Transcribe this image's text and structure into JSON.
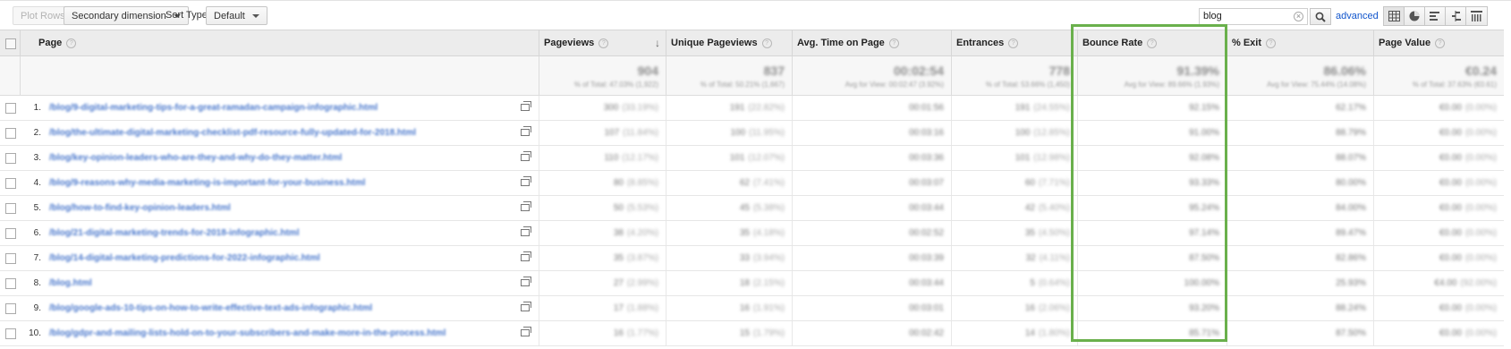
{
  "toolbar": {
    "plot_rows": "Plot Rows",
    "secondary_dimension": "Secondary dimension",
    "sort_type_label": "Sort Type:",
    "sort_type_value": "Default",
    "search_value": "blog",
    "advanced": "advanced"
  },
  "columns": {
    "page": "Page",
    "pageviews": "Pageviews",
    "unique_pageviews": "Unique Pageviews",
    "avg_time": "Avg. Time on Page",
    "entrances": "Entrances",
    "bounce_rate": "Bounce Rate",
    "exit": "% Exit",
    "page_value": "Page Value"
  },
  "totals": {
    "pageviews": "904",
    "unique_pageviews": "837",
    "avg_time": "00:02:54",
    "entrances": "778",
    "bounce_rate": "91.39%",
    "exit": "86.06%",
    "page_value": "€0.24"
  },
  "rows": [
    {
      "num": "1.",
      "page": "/blog/9-digital-marketing-tips-for-a-great-ramadan-campaign-infographic.html",
      "pv": "300",
      "pvp": "(33.19%)",
      "upv": "191",
      "upvp": "(22.82%)",
      "time": "00:01:56",
      "ent": "191",
      "entp": "(24.55%)",
      "br": "92.15%",
      "ex": "62.17%",
      "val": "€0.00",
      "valp": "(0.00%)"
    },
    {
      "num": "2.",
      "page": "/blog/the-ultimate-digital-marketing-checklist-pdf-resource-fully-updated-for-2018.html",
      "pv": "107",
      "pvp": "(11.84%)",
      "upv": "100",
      "upvp": "(11.95%)",
      "time": "00:03:16",
      "ent": "100",
      "entp": "(12.85%)",
      "br": "91.00%",
      "ex": "88.79%",
      "val": "€0.00",
      "valp": "(0.00%)"
    },
    {
      "num": "3.",
      "page": "/blog/key-opinion-leaders-who-are-they-and-why-do-they-matter.html",
      "pv": "110",
      "pvp": "(12.17%)",
      "upv": "101",
      "upvp": "(12.07%)",
      "time": "00:03:36",
      "ent": "101",
      "entp": "(12.98%)",
      "br": "92.08%",
      "ex": "88.07%",
      "val": "€0.00",
      "valp": "(0.00%)"
    },
    {
      "num": "4.",
      "page": "/blog/9-reasons-why-media-marketing-is-important-for-your-business.html",
      "pv": "80",
      "pvp": "(8.85%)",
      "upv": "62",
      "upvp": "(7.41%)",
      "time": "00:03:07",
      "ent": "60",
      "entp": "(7.71%)",
      "br": "93.33%",
      "ex": "80.00%",
      "val": "€0.00",
      "valp": "(0.00%)"
    },
    {
      "num": "5.",
      "page": "/blog/how-to-find-key-opinion-leaders.html",
      "pv": "50",
      "pvp": "(5.53%)",
      "upv": "45",
      "upvp": "(5.38%)",
      "time": "00:03:44",
      "ent": "42",
      "entp": "(5.40%)",
      "br": "95.24%",
      "ex": "84.00%",
      "val": "€0.00",
      "valp": "(0.00%)"
    },
    {
      "num": "6.",
      "page": "/blog/21-digital-marketing-trends-for-2018-infographic.html",
      "pv": "38",
      "pvp": "(4.20%)",
      "upv": "35",
      "upvp": "(4.18%)",
      "time": "00:02:52",
      "ent": "35",
      "entp": "(4.50%)",
      "br": "97.14%",
      "ex": "89.47%",
      "val": "€0.00",
      "valp": "(0.00%)"
    },
    {
      "num": "7.",
      "page": "/blog/14-digital-marketing-predictions-for-2022-infographic.html",
      "pv": "35",
      "pvp": "(3.87%)",
      "upv": "33",
      "upvp": "(3.94%)",
      "time": "00:03:39",
      "ent": "32",
      "entp": "(4.11%)",
      "br": "87.50%",
      "ex": "82.86%",
      "val": "€0.00",
      "valp": "(0.00%)"
    },
    {
      "num": "8.",
      "page": "/blog.html",
      "pv": "27",
      "pvp": "(2.99%)",
      "upv": "18",
      "upvp": "(2.15%)",
      "time": "00:03:44",
      "ent": "5",
      "entp": "(0.64%)",
      "br": "100.00%",
      "ex": "25.93%",
      "val": "€4.00",
      "valp": "(92.00%)"
    },
    {
      "num": "9.",
      "page": "/blog/google-ads-10-tips-on-how-to-write-effective-text-ads-infographic.html",
      "pv": "17",
      "pvp": "(1.88%)",
      "upv": "16",
      "upvp": "(1.91%)",
      "time": "00:03:01",
      "ent": "16",
      "entp": "(2.06%)",
      "br": "93.20%",
      "ex": "88.24%",
      "val": "€0.00",
      "valp": "(0.00%)"
    },
    {
      "num": "10.",
      "page": "/blog/gdpr-and-mailing-lists-hold-on-to-your-subscribers-and-make-more-in-the-process.html",
      "pv": "16",
      "pvp": "(1.77%)",
      "upv": "15",
      "upvp": "(1.79%)",
      "time": "00:02:42",
      "ent": "14",
      "entp": "(1.80%)",
      "br": "85.71%",
      "ex": "87.50%",
      "val": "€0.00",
      "valp": "(0.00%)"
    }
  ],
  "highlight_color": "#6ab04c",
  "link_color": "#4a78cc"
}
